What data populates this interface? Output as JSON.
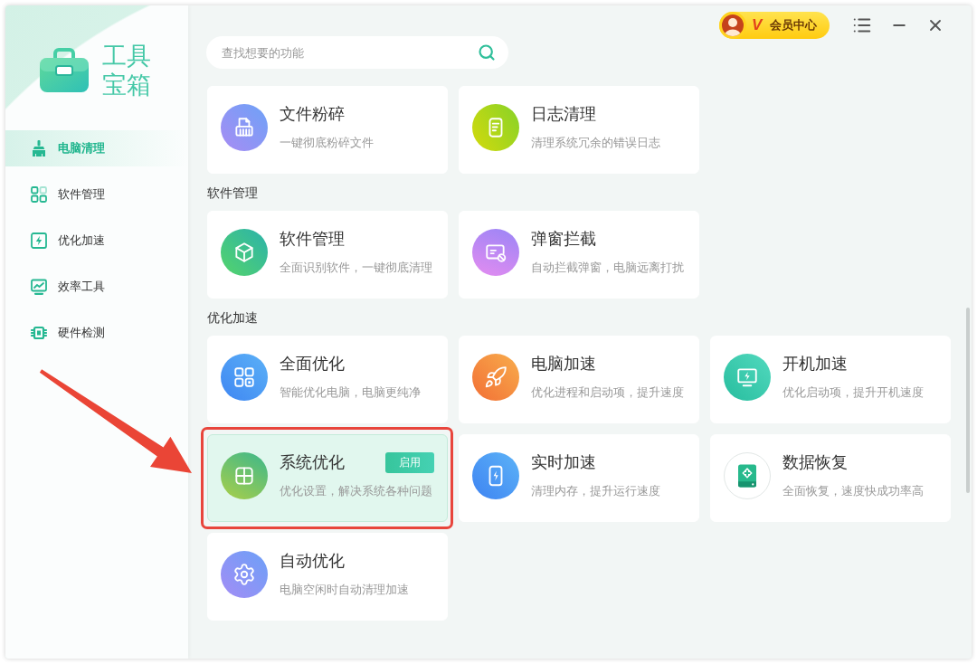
{
  "app": {
    "title": "工具宝箱"
  },
  "sidebar": {
    "items": [
      {
        "label": "电脑清理",
        "selected": true
      },
      {
        "label": "软件管理",
        "selected": false
      },
      {
        "label": "优化加速",
        "selected": false
      },
      {
        "label": "效率工具",
        "selected": false
      },
      {
        "label": "硬件检测",
        "selected": false
      }
    ]
  },
  "header": {
    "member_button": {
      "mark": "V",
      "label": "会员中心"
    },
    "search": {
      "placeholder": "查找想要的功能"
    }
  },
  "sections": [
    {
      "cards": [
        {
          "title": "文件粉碎",
          "description": "一键彻底粉碎文件",
          "selected": false,
          "highlighted": false
        },
        {
          "title": "日志清理",
          "description": "清理系统冗余的错误日志",
          "selected": false,
          "highlighted": false
        }
      ]
    },
    {
      "title": "软件管理",
      "cards": [
        {
          "title": "软件管理",
          "description": "全面识别软件，一键彻底清理",
          "selected": false,
          "highlighted": false
        },
        {
          "title": "弹窗拦截",
          "description": "自动拦截弹窗，电脑远离打扰",
          "selected": false,
          "highlighted": false
        }
      ]
    },
    {
      "title": "优化加速",
      "cards": [
        {
          "title": "全面优化",
          "description": "智能优化电脑，电脑更纯净",
          "selected": false,
          "highlighted": false
        },
        {
          "title": "电脑加速",
          "description": "优化进程和启动项，提升速度",
          "selected": false,
          "highlighted": false
        },
        {
          "title": "开机加速",
          "description": "优化启动项，提升开机速度",
          "selected": false,
          "highlighted": false
        },
        {
          "title": "系统优化",
          "description": "优化设置，解决系统各种问题",
          "selected": true,
          "highlighted": true,
          "action": "启用"
        },
        {
          "title": "实时加速",
          "description": "清理内存，提升运行速度",
          "selected": false,
          "highlighted": false
        },
        {
          "title": "数据恢复",
          "description": "全面恢复，速度快成功率高",
          "selected": false,
          "highlighted": false
        },
        {
          "title": "自动优化",
          "description": "电脑空闲时自动清理加速",
          "selected": false,
          "highlighted": false
        }
      ]
    }
  ],
  "annotation": {
    "arrow": true
  }
}
